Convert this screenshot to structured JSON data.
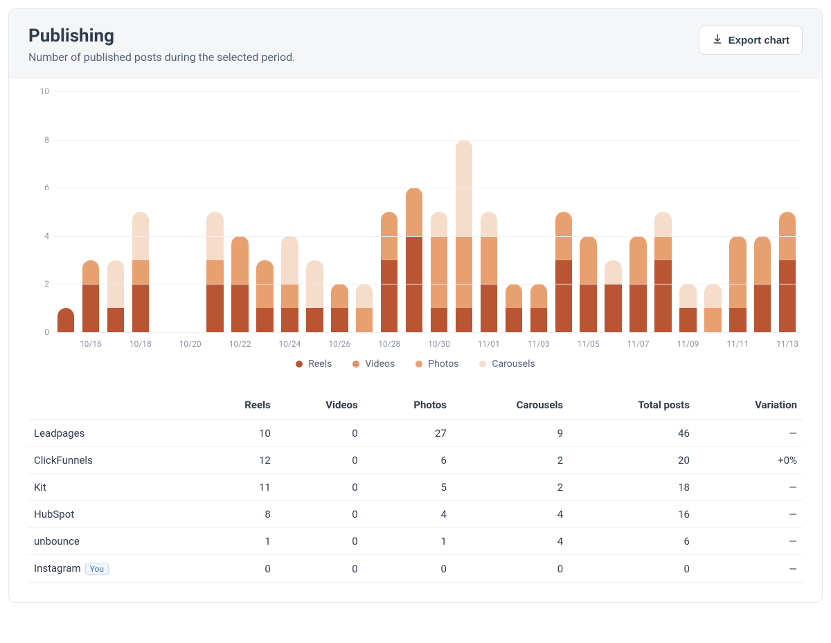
{
  "header": {
    "title": "Publishing",
    "subtitle": "Number of published posts during the selected period.",
    "export_label": "Export chart"
  },
  "legend": {
    "reels": "Reels",
    "videos": "Videos",
    "photos": "Photos",
    "carousels": "Carousels"
  },
  "chart_data": {
    "type": "bar",
    "stacked": true,
    "ylabel": "",
    "xlabel": "",
    "ylim": [
      0,
      10
    ],
    "yticks": [
      0,
      2,
      4,
      6,
      8,
      10
    ],
    "categories": [
      "10/15",
      "10/16",
      "10/17",
      "10/18",
      "10/19",
      "10/20",
      "10/21",
      "10/22",
      "10/23",
      "10/24",
      "10/25",
      "10/26",
      "10/27",
      "10/28",
      "10/29",
      "10/30",
      "10/31",
      "11/01",
      "11/02",
      "11/03",
      "11/04",
      "11/05",
      "11/06",
      "11/07",
      "11/08",
      "11/09",
      "11/10",
      "11/11",
      "11/12",
      "11/13"
    ],
    "xtick_labels": [
      "",
      "10/16",
      "",
      "10/18",
      "",
      "10/20",
      "",
      "10/22",
      "",
      "10/24",
      "",
      "10/26",
      "",
      "10/28",
      "",
      "10/30",
      "",
      "11/01",
      "",
      "11/03",
      "",
      "11/05",
      "",
      "11/07",
      "",
      "11/09",
      "",
      "11/11",
      "",
      "11/13"
    ],
    "series": [
      {
        "name": "Reels",
        "key": "reels",
        "color": "#b95533",
        "values": [
          1,
          2,
          1,
          2,
          0,
          0,
          2,
          2,
          1,
          1,
          1,
          1,
          0,
          3,
          4,
          1,
          1,
          2,
          1,
          1,
          3,
          2,
          2,
          2,
          3,
          1,
          0,
          1,
          2,
          3
        ]
      },
      {
        "name": "Videos",
        "key": "videos",
        "color": "#e9a071",
        "values": [
          0,
          0,
          0,
          0,
          0,
          0,
          0,
          0,
          0,
          0,
          0,
          0,
          0,
          0,
          0,
          0,
          0,
          0,
          0,
          0,
          0,
          0,
          0,
          0,
          0,
          0,
          0,
          0,
          0,
          0
        ]
      },
      {
        "name": "Photos",
        "key": "photos",
        "color": "#e9a071",
        "values": [
          0,
          1,
          0,
          1,
          0,
          0,
          1,
          2,
          2,
          1,
          0,
          1,
          1,
          2,
          2,
          3,
          3,
          2,
          1,
          1,
          2,
          2,
          0,
          2,
          1,
          0,
          1,
          3,
          2,
          2
        ]
      },
      {
        "name": "Carousels",
        "key": "carousels",
        "color": "#f6dccb",
        "values": [
          0,
          0,
          2,
          2,
          0,
          0,
          2,
          0,
          0,
          2,
          2,
          0,
          1,
          0,
          0,
          1,
          4,
          1,
          0,
          0,
          0,
          0,
          1,
          0,
          1,
          1,
          1,
          0,
          0,
          0
        ]
      }
    ]
  },
  "table": {
    "columns": [
      "",
      "Reels",
      "Videos",
      "Photos",
      "Carousels",
      "Total posts",
      "Variation"
    ],
    "rows": [
      {
        "name": "Leadpages",
        "you": false,
        "reels": 10,
        "videos": 0,
        "photos": 27,
        "carousels": 9,
        "total": 46,
        "variation": "—"
      },
      {
        "name": "ClickFunnels",
        "you": false,
        "reels": 12,
        "videos": 0,
        "photos": 6,
        "carousels": 2,
        "total": 20,
        "variation": "+0%"
      },
      {
        "name": "Kit",
        "you": false,
        "reels": 11,
        "videos": 0,
        "photos": 5,
        "carousels": 2,
        "total": 18,
        "variation": "—"
      },
      {
        "name": "HubSpot",
        "you": false,
        "reels": 8,
        "videos": 0,
        "photos": 4,
        "carousels": 4,
        "total": 16,
        "variation": "—"
      },
      {
        "name": "unbounce",
        "you": false,
        "reels": 1,
        "videos": 0,
        "photos": 1,
        "carousels": 4,
        "total": 6,
        "variation": "—"
      },
      {
        "name": "Instagram",
        "you": true,
        "reels": 0,
        "videos": 0,
        "photos": 0,
        "carousels": 0,
        "total": 0,
        "variation": "—"
      }
    ],
    "you_label": "You"
  }
}
